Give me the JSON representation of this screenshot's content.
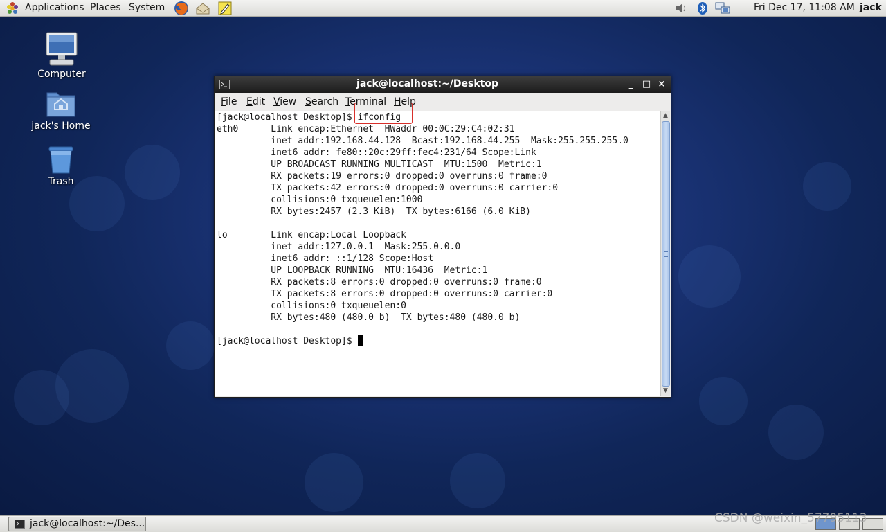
{
  "top_panel": {
    "menus": [
      "Applications",
      "Places",
      "System"
    ],
    "datetime": "Fri Dec 17, 11:08 AM",
    "user": "jack",
    "launchers": [
      "firefox-icon",
      "mail-icon",
      "notes-icon"
    ],
    "tray": [
      "volume-icon",
      "bluetooth-icon",
      "network-icon"
    ]
  },
  "desktop": {
    "icons": [
      {
        "label": "Computer",
        "icon": "computer-icon"
      },
      {
        "label": "jack's Home",
        "icon": "home-folder-icon"
      },
      {
        "label": "Trash",
        "icon": "trash-icon"
      }
    ]
  },
  "terminal": {
    "title": "jack@localhost:~/Desktop",
    "menu": [
      "File",
      "Edit",
      "View",
      "Search",
      "Terminal",
      "Help"
    ],
    "lines": [
      "[jack@localhost Desktop]$ ifconfig",
      "eth0      Link encap:Ethernet  HWaddr 00:0C:29:C4:02:31",
      "          inet addr:192.168.44.128  Bcast:192.168.44.255  Mask:255.255.255.0",
      "          inet6 addr: fe80::20c:29ff:fec4:231/64 Scope:Link",
      "          UP BROADCAST RUNNING MULTICAST  MTU:1500  Metric:1",
      "          RX packets:19 errors:0 dropped:0 overruns:0 frame:0",
      "          TX packets:42 errors:0 dropped:0 overruns:0 carrier:0",
      "          collisions:0 txqueuelen:1000",
      "          RX bytes:2457 (2.3 KiB)  TX bytes:6166 (6.0 KiB)",
      "",
      "lo        Link encap:Local Loopback",
      "          inet addr:127.0.0.1  Mask:255.0.0.0",
      "          inet6 addr: ::1/128 Scope:Host",
      "          UP LOOPBACK RUNNING  MTU:16436  Metric:1",
      "          RX packets:8 errors:0 dropped:0 overruns:0 frame:0",
      "          TX packets:8 errors:0 dropped:0 overruns:0 carrier:0",
      "          collisions:0 txqueuelen:0",
      "          RX bytes:480 (480.0 b)  TX bytes:480 (480.0 b)",
      ""
    ],
    "prompt": "[jack@localhost Desktop]$ ",
    "highlight_color": "#d8302b"
  },
  "bottom_panel": {
    "task_label": "jack@localhost:~/Des..."
  },
  "watermark": "CSDN @weixin_57795113"
}
